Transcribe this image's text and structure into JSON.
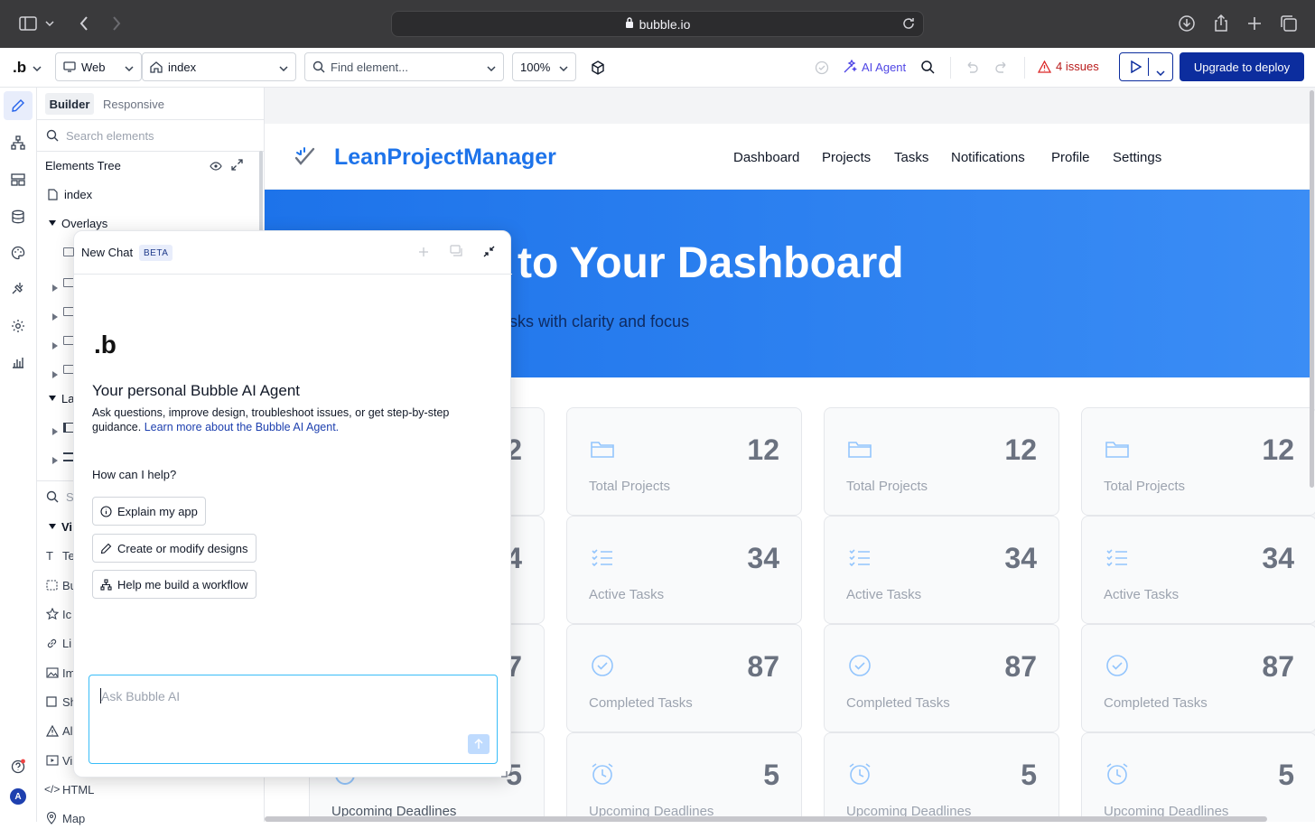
{
  "browser": {
    "url": "bubble.io"
  },
  "toolbar": {
    "platform": "Web",
    "page": "index",
    "find_placeholder": "Find element...",
    "zoom": "100%",
    "ai_agent": "AI Agent",
    "issues": "4 issues",
    "upgrade": "Upgrade to deploy"
  },
  "panel": {
    "tab_builder": "Builder",
    "tab_responsive": "Responsive",
    "search_placeholder": "Search elements",
    "tree_title": "Elements Tree",
    "tree_index": "index",
    "tree_overlays": "Overlays",
    "tree_la": "La",
    "vi": "Vi",
    "items": [
      "Te",
      "Bu",
      "Ic",
      "Li",
      "Im",
      "Sh",
      "Al",
      "Vi"
    ],
    "html": "HTML",
    "map": "Map",
    "s": "S"
  },
  "chat": {
    "title": "New Chat",
    "badge": "BETA",
    "logo": ".b",
    "heading": "Your personal Bubble AI Agent",
    "desc": "Ask questions, improve design, troubleshoot issues, or get step-by-step guidance.",
    "learn_link": "Learn more about the Bubble AI Agent.",
    "prompt": "How can I help?",
    "suggestions": [
      "Explain my app",
      "Create or modify designs",
      "Help me build a workflow"
    ],
    "input_placeholder": "Ask Bubble AI"
  },
  "app": {
    "brand": "LeanProjectManager",
    "nav": [
      "Dashboard",
      "Projects",
      "Tasks",
      "Notifications",
      "Profile",
      "Settings"
    ],
    "hero_title": "to Your Dashboard",
    "hero_sub": "sks with clarity and focus",
    "partial_numbers": [
      "2",
      "4",
      "7",
      "5"
    ],
    "partial_label": "Upcoming Deadlines",
    "cards": [
      {
        "value": "12",
        "label": "Total Projects",
        "icon": "folder-icon"
      },
      {
        "value": "34",
        "label": "Active Tasks",
        "icon": "list-check-icon"
      },
      {
        "value": "87",
        "label": "Completed Tasks",
        "icon": "check-circle-icon"
      },
      {
        "value": "5",
        "label": "Upcoming Deadlines",
        "icon": "alarm-clock-icon"
      }
    ]
  },
  "colors": {
    "accent": "#1d73ea",
    "deploy": "#0c2d9e",
    "issues": "#b91c1c"
  }
}
